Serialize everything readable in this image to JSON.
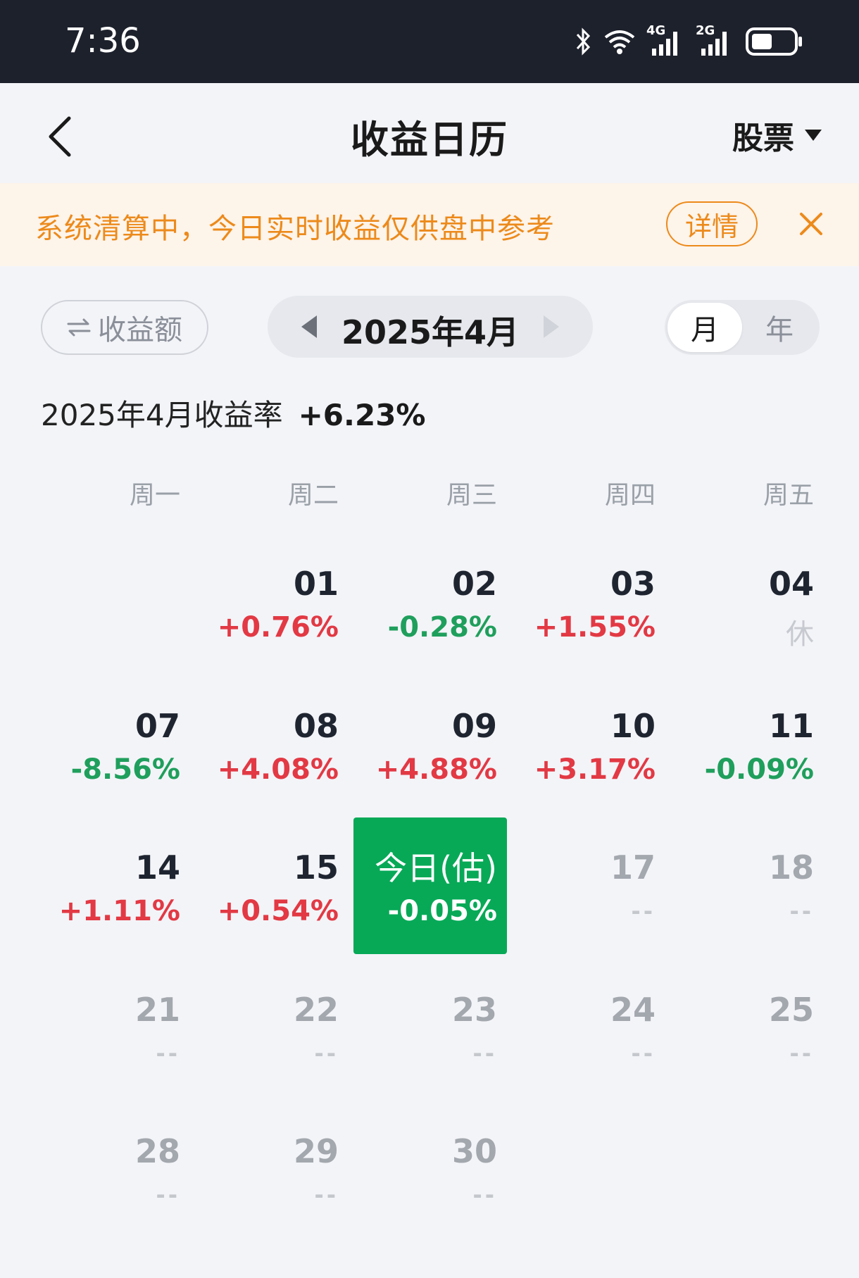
{
  "status": {
    "time": "7:36",
    "net1": "4G",
    "net2": "2G"
  },
  "header": {
    "title": "收益日历",
    "filter_label": "股票"
  },
  "notice": {
    "text": "系统清算中，今日实时收益仅供盘中参考",
    "detail_label": "详情"
  },
  "controls": {
    "metric_toggle": "收益额",
    "month_label": "2025年4月",
    "period_month": "月",
    "period_year": "年"
  },
  "summary": {
    "label": "2025年4月收益率",
    "value": "+6.23%"
  },
  "weekdays": [
    "周一",
    "周二",
    "周三",
    "周四",
    "周五"
  ],
  "days": [
    {
      "num": "01",
      "rate": "+0.76%",
      "trend": "up"
    },
    {
      "num": "02",
      "rate": "-0.28%",
      "trend": "down"
    },
    {
      "num": "03",
      "rate": "+1.55%",
      "trend": "up"
    },
    {
      "num": "04",
      "rate": "休",
      "trend": "rest"
    },
    {
      "num": "07",
      "rate": "-8.56%",
      "trend": "down"
    },
    {
      "num": "08",
      "rate": "+4.08%",
      "trend": "up"
    },
    {
      "num": "09",
      "rate": "+4.88%",
      "trend": "up"
    },
    {
      "num": "10",
      "rate": "+3.17%",
      "trend": "up"
    },
    {
      "num": "11",
      "rate": "-0.09%",
      "trend": "down"
    },
    {
      "num": "14",
      "rate": "+1.11%",
      "trend": "up"
    },
    {
      "num": "15",
      "rate": "+0.54%",
      "trend": "up"
    },
    {
      "num": "17",
      "rate": "--",
      "trend": "future"
    },
    {
      "num": "18",
      "rate": "--",
      "trend": "future"
    },
    {
      "num": "21",
      "rate": "--",
      "trend": "future"
    },
    {
      "num": "22",
      "rate": "--",
      "trend": "future"
    },
    {
      "num": "23",
      "rate": "--",
      "trend": "future"
    },
    {
      "num": "24",
      "rate": "--",
      "trend": "future"
    },
    {
      "num": "25",
      "rate": "--",
      "trend": "future"
    },
    {
      "num": "28",
      "rate": "--",
      "trend": "future"
    },
    {
      "num": "29",
      "rate": "--",
      "trend": "future"
    },
    {
      "num": "30",
      "rate": "--",
      "trend": "future"
    }
  ],
  "today": {
    "label": "今日(估)",
    "rate": "-0.05%"
  },
  "colors": {
    "up": "#e23944",
    "down": "#1f9f5c",
    "today_bg": "#07a957",
    "notice": "#ec8a1b"
  }
}
